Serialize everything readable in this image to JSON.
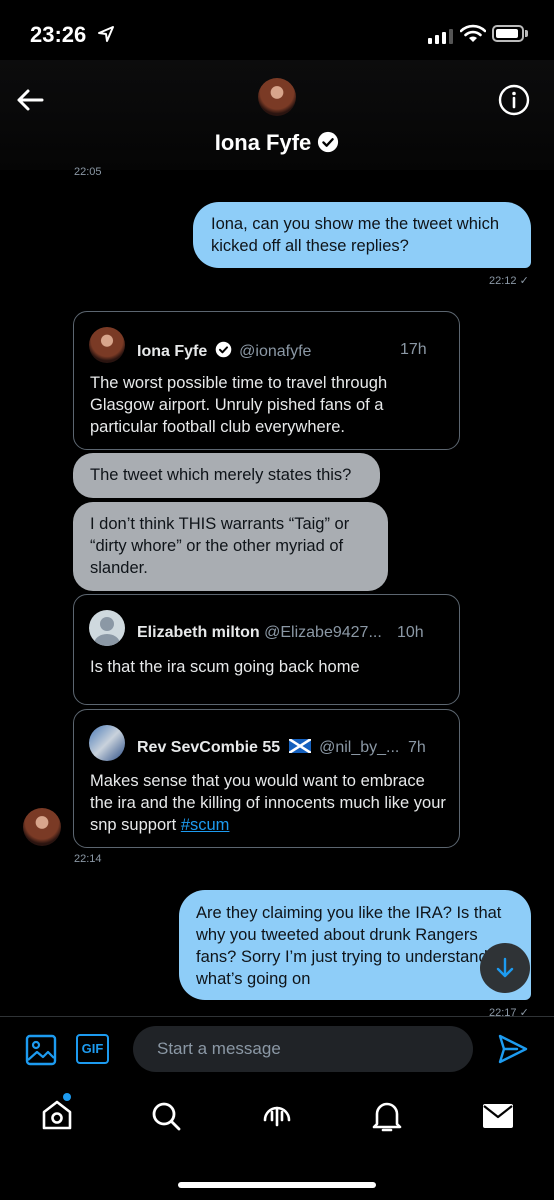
{
  "status_bar": {
    "time": "23:26"
  },
  "header": {
    "name": "Iona Fyfe"
  },
  "messages": {
    "top_timestamp": "22:05",
    "sent1": {
      "text": "Iona, can you show me the tweet which kicked off all these replies?",
      "time": "22:12 ✓"
    },
    "tweet1": {
      "name": "Iona Fyfe",
      "handle": "@ionafyfe",
      "time": "17h",
      "text": "The worst possible time to travel through Glasgow airport. Unruly pished fans of a particular football club everywhere."
    },
    "recv1": "The tweet which merely states this?",
    "recv2": "I don’t think THIS warrants “Taig” or “dirty whore” or the other myriad of slander.",
    "tweet2": {
      "name": "Elizabeth milton",
      "handle": "@Elizabe9427...",
      "time": "10h",
      "text": "Is that the ira scum going back home"
    },
    "tweet3": {
      "name": "Rev SevCombie 55",
      "flag": "🏴󠁧󠁢󠁳󠁣󠁴󠁿",
      "handle": "@nil_by_...",
      "time": "7h",
      "text": "Makes sense that you would want to embrace the ira and the killing of innocents much like your snp support",
      "hashtag": "#scum"
    },
    "recv_time": "22:14",
    "sent2": {
      "text": "Are they claiming you like the IRA? Is that why you tweeted about drunk Rangers fans? Sorry I’m just trying to understand what’s going on",
      "time": "22:17 ✓"
    }
  },
  "composer": {
    "placeholder": "Start a message",
    "gif_label": "GIF"
  },
  "colors": {
    "accent": "#1d9bf0",
    "sent_bubble": "#8ecdf8",
    "received_bubble": "#a9adb2"
  },
  "icons": [
    "back-arrow-icon",
    "info-icon",
    "verified-icon",
    "image-icon",
    "gif-icon",
    "send-icon",
    "home-icon",
    "search-icon",
    "spaces-icon",
    "notifications-icon",
    "messages-icon"
  ]
}
